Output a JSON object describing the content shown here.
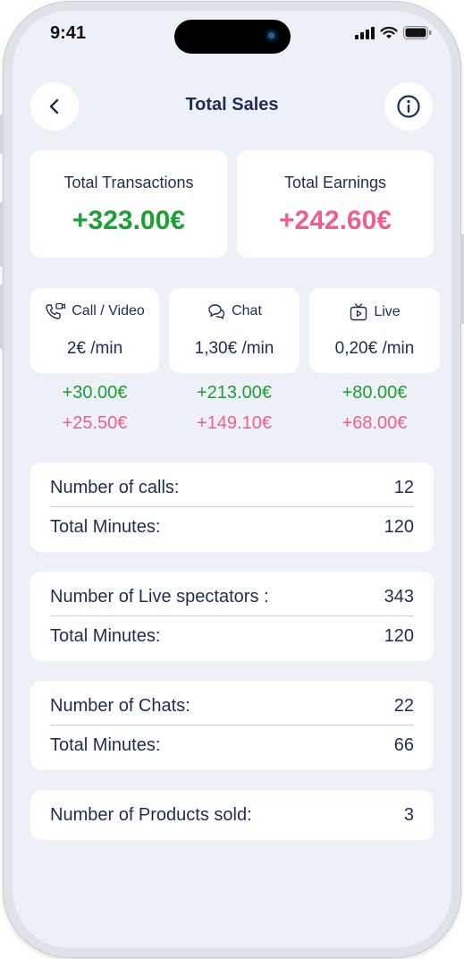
{
  "status_bar": {
    "time": "9:41"
  },
  "header": {
    "title": "Total Sales",
    "back_icon": "chevron-left-icon",
    "info_icon": "info-icon"
  },
  "summary": {
    "transactions_label": "Total Transactions",
    "transactions_value": "+323.00€",
    "earnings_label": "Total Earnings",
    "earnings_value": "+242.60€"
  },
  "services": [
    {
      "label": "Call / Video",
      "icon": "phone-video-icon",
      "rate": "2€ /min",
      "gross": "+30.00€",
      "net": "+25.50€"
    },
    {
      "label": "Chat",
      "icon": "chat-icon",
      "rate": "1,30€ /min",
      "gross": "+213.00€",
      "net": "+149.10€"
    },
    {
      "label": "Live",
      "icon": "tv-play-icon",
      "rate": "0,20€ /min",
      "gross": "+80.00€",
      "net": "+68.00€"
    }
  ],
  "stats": {
    "calls": {
      "count_label": "Number of calls:",
      "count_value": "12",
      "minutes_label": "Total Minutes:",
      "minutes_value": "120"
    },
    "live": {
      "count_label": "Number of Live spectators :",
      "count_value": "343",
      "minutes_label": "Total Minutes:",
      "minutes_value": "120"
    },
    "chats": {
      "count_label": "Number of Chats:",
      "count_value": "22",
      "minutes_label": "Total Minutes:",
      "minutes_value": "66"
    },
    "products": {
      "count_label": "Number of Products sold:",
      "count_value": "3"
    }
  },
  "colors": {
    "positive": "#1aa132",
    "net": "#ef5f8d",
    "text": "#1f2d52",
    "background": "#edf1f7"
  }
}
